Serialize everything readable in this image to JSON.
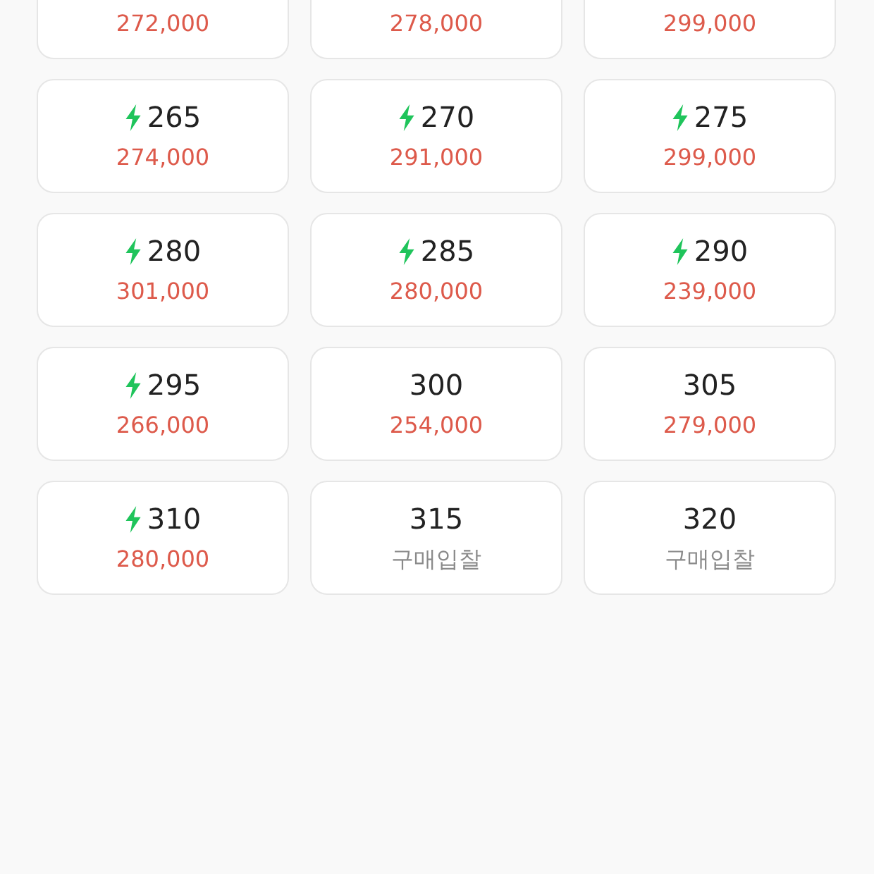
{
  "sizes": [
    {
      "price": "272,000",
      "kind": "price"
    },
    {
      "price": "278,000",
      "kind": "price"
    },
    {
      "price": "299,000",
      "kind": "price"
    },
    {
      "size": "265",
      "price": "274,000",
      "kind": "price",
      "express": true
    },
    {
      "size": "270",
      "price": "291,000",
      "kind": "price",
      "express": true
    },
    {
      "size": "275",
      "price": "299,000",
      "kind": "price",
      "express": true
    },
    {
      "size": "280",
      "price": "301,000",
      "kind": "price",
      "express": true
    },
    {
      "size": "285",
      "price": "280,000",
      "kind": "price",
      "express": true
    },
    {
      "size": "290",
      "price": "239,000",
      "kind": "price",
      "express": true
    },
    {
      "size": "295",
      "price": "266,000",
      "kind": "price",
      "express": true
    },
    {
      "size": "300",
      "price": "254,000",
      "kind": "price",
      "express": false
    },
    {
      "size": "305",
      "price": "279,000",
      "kind": "price",
      "express": false
    },
    {
      "size": "310",
      "price": "280,000",
      "kind": "price",
      "express": true
    },
    {
      "size": "315",
      "price": "구매입찰",
      "kind": "bid",
      "express": false
    },
    {
      "size": "320",
      "price": "구매입찰",
      "kind": "bid",
      "express": false
    }
  ]
}
